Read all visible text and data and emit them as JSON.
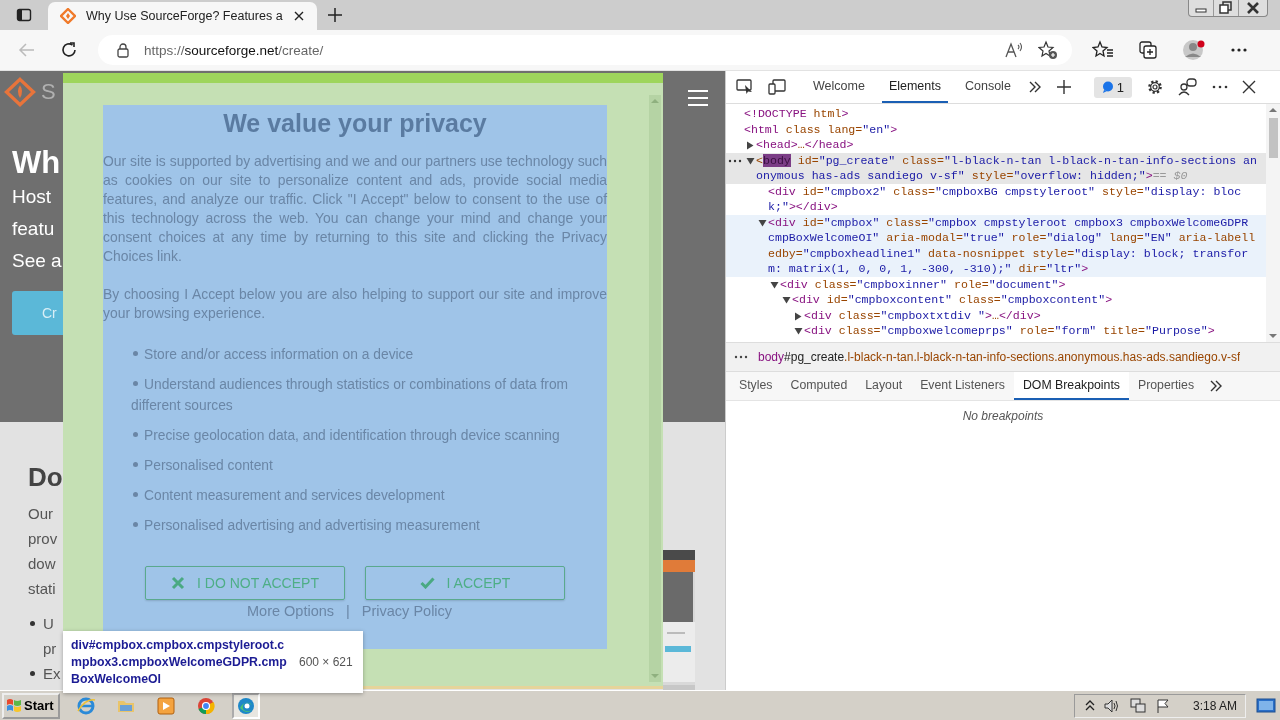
{
  "browser": {
    "tabs": [
      {
        "title": "Why Use SourceForge? Features a",
        "selected": true
      }
    ],
    "address": {
      "scheme": "https://",
      "host": "sourceforge.net",
      "path": "/create/"
    }
  },
  "page": {
    "logo_text": "S",
    "heading": "Wh",
    "intro_lines": [
      "Host",
      "featu",
      "See a"
    ],
    "button": "Cr",
    "section_heading": "Do",
    "section_lines": [
      "Our",
      "prov",
      "dow",
      "stati"
    ],
    "bullets": [
      [
        "U",
        "pr"
      ],
      [
        "Ex"
      ]
    ]
  },
  "consent": {
    "title": "We value your privacy",
    "paragraphs": [
      "Our site is supported by advertising and we and our partners use technology such as cookies on our site to personalize content and ads, provide social media features, and analyze our traffic. Click \"I Accept\" below to consent to the use of this technology across the web. You can change your mind and change your consent choices at any time by returning to this site and clicking the Privacy Choices link.",
      "By choosing I Accept below you are also helping to support our site and improve your browsing experience."
    ],
    "purposes": [
      "Store and/or access information on a device",
      "Understand audiences through statistics or combinations of data from different sources",
      "Precise geolocation data, and identification through device scanning",
      "Personalised content",
      "Content measurement and services development",
      "Personalised advertising and advertising measurement"
    ],
    "buttons": [
      {
        "kind": "reject",
        "label": "I DO NOT ACCEPT"
      },
      {
        "kind": "accept",
        "label": "I ACCEPT"
      }
    ],
    "links": [
      "More Options",
      "Privacy Policy"
    ],
    "separator": "|"
  },
  "inspector_tooltip": {
    "selector": "div#cmpbox.cmpbox.cmpstyleroot.cmpbox3.cmpboxWelcomeGDPR.cmpBoxWelcomeOI",
    "size": "600 × 621"
  },
  "devtools": {
    "tabs": [
      {
        "label": "Welcome",
        "selected": false
      },
      {
        "label": "Elements",
        "selected": true
      },
      {
        "label": "Console",
        "selected": false
      }
    ],
    "issues": "1",
    "dom": [
      {
        "text": "<!DOCTYPE html>",
        "selected": false,
        "hovered": false
      },
      {
        "text": "<html class lang=\"en\">",
        "selected": false,
        "hovered": false,
        "children": [
          {
            "text": "<head>…</head>",
            "expanded": false,
            "selected": false,
            "hovered": false
          },
          {
            "prefix": "<",
            "match": "body",
            "text": " id=\"pg_create\" class=\"l-black-n-tan l-black-n-tan-info-sections anonymous has-ads sandiego v-sf\" style=\"overflow: hidden;\">",
            "suffix": "== $0",
            "expanded": true,
            "selected": true,
            "hovered": false,
            "children": [
              {
                "text": "<div id=\"cmpbox2\" class=\"cmpboxBG cmpstyleroot\" style=\"display: block;\"></div>",
                "selected": false,
                "hovered": false
              },
              {
                "text": "<div id=\"cmpbox\" class=\"cmpbox cmpstyleroot cmpbox3 cmpboxWelcomeGDPR cmpBoxWelcomeOI\" aria-modal=\"true\" role=\"dialog\" lang=\"EN\" aria-labelledby=\"cmpboxheadline1\" data-nosnippet style=\"display: block; transform: matrix(1, 0, 0, 1, -300, -310);\" dir=\"ltr\">",
                "expanded": true,
                "selected": false,
                "hovered": true,
                "children": [
                  {
                    "text": "<div class=\"cmpboxinner\" role=\"document\">",
                    "expanded": true,
                    "selected": false,
                    "hovered": false,
                    "children": [
                      {
                        "text": "<div id=\"cmpboxcontent\" class=\"cmpboxcontent\">",
                        "expanded": true,
                        "selected": false,
                        "hovered": false,
                        "children": [
                          {
                            "text": "<div class=\"cmpboxtxtdiv \">…</div>",
                            "expanded": false,
                            "selected": false,
                            "hovered": false
                          },
                          {
                            "text": "<div class=\"cmpboxwelcomeprps\" role=\"form\" title=\"Purpose\">",
                            "expanded": true,
                            "selected": false,
                            "hovered": false
                          }
                        ]
                      }
                    ]
                  }
                ]
              }
            ]
          }
        ]
      }
    ],
    "breadcrumb": {
      "tag": "body",
      "id": "#pg_create",
      "classes": ".l-black-n-tan.l-black-n-tan-info-sections.anonymous.has-ads.sandiego.v-sf"
    },
    "subtabs": [
      {
        "label": "Styles",
        "selected": false
      },
      {
        "label": "Computed",
        "selected": false
      },
      {
        "label": "Layout",
        "selected": false
      },
      {
        "label": "Event Listeners",
        "selected": false
      },
      {
        "label": "DOM Breakpoints",
        "selected": true
      },
      {
        "label": "Properties",
        "selected": false
      }
    ],
    "empty_message": "No breakpoints"
  },
  "taskbar": {
    "start": "Start",
    "apps": [
      {
        "kind": "ie",
        "active": false
      },
      {
        "kind": "folder",
        "active": false
      },
      {
        "kind": "media",
        "active": false
      },
      {
        "kind": "chrome",
        "active": false
      },
      {
        "kind": "edge",
        "active": true
      }
    ],
    "time": "3:18 AM"
  }
}
